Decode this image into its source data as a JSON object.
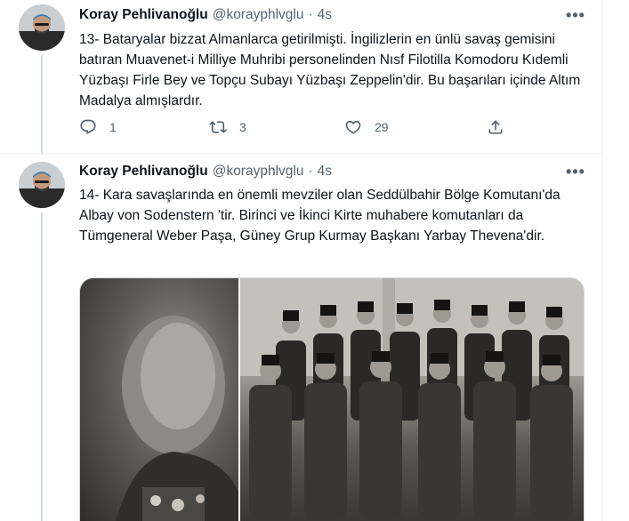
{
  "tweets": [
    {
      "author_name": "Koray Pehlivanoğlu",
      "handle": "@korayphlvglu",
      "separator": "·",
      "time": "4s",
      "more_label": "•••",
      "text": "13- Bataryalar bizzat Almanlarca getirilmişti. İngilizlerin en ünlü savaş gemisini batıran Muavenet-i Milliye Muhribi personelinden Nısf Filotilla Komodoru Kıdemli Yüzbaşı Firle Bey ve Topçu Subayı Yüzbaşı Zeppelin'dir. Bu başarıları içinde Altım Madalya almışlardır.",
      "replies": "1",
      "retweets": "3",
      "likes": "29"
    },
    {
      "author_name": "Koray Pehlivanoğlu",
      "handle": "@korayphlvglu",
      "separator": "·",
      "time": "4s",
      "more_label": "•••",
      "text": "14- Kara savaşlarında en önemli mevziler olan Seddülbahir Bölge Komutanı'da Albay von Sodenstern 'tir. Birinci ve İkinci Kirte muhabere komutanları da Tümgeneral Weber Paşa, Güney Grup Kurmay Başkanı Yarbay Thevena'dir."
    }
  ],
  "icons": {
    "reply": "reply-icon",
    "retweet": "retweet-icon",
    "like": "heart-icon",
    "share": "share-icon",
    "more": "more-icon"
  },
  "colors": {
    "text": "#0f1419",
    "secondary": "#536471",
    "thread_line": "#cfd9de",
    "divider": "#eff3f4"
  }
}
